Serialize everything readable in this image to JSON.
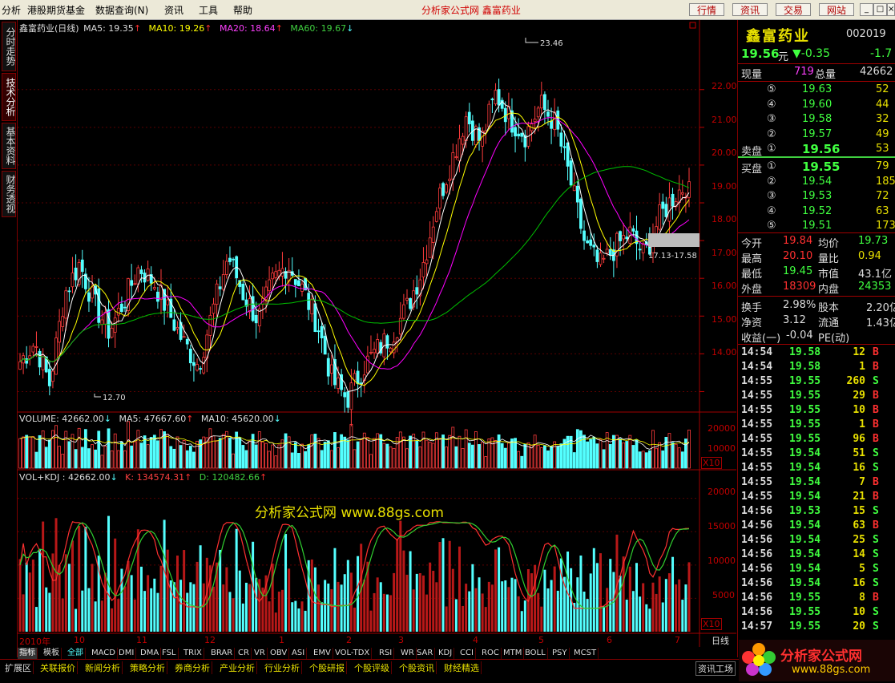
{
  "menu": {
    "items": [
      "分析",
      "港股期货基金",
      "数据查询(N)",
      "资讯",
      "工具",
      "帮助"
    ],
    "center_title": "分析家公式网  鑫富药业",
    "right_buttons": [
      "行情",
      "资讯",
      "交易",
      "网站"
    ],
    "window_buttons": [
      "_",
      "□",
      "×"
    ]
  },
  "left_tabs": [
    "分时走势",
    "技术分析",
    "基本资料",
    "财务透视"
  ],
  "chart": {
    "legend_main": {
      "name": "鑫富药业(日线)",
      "ma5": "MA5: 19.35",
      "ma10": "MA10: 19.26",
      "ma20": "MA20: 18.64",
      "ma60": "MA60: 19.67"
    },
    "legend_volume": {
      "volume": "VOLUME: 42662.00",
      "ma5": "MA5: 47667.60",
      "ma10": "MA10: 45620.00"
    },
    "legend_kdj": {
      "vol": "VOL+KDJ : 42662.00",
      "k": "K: 134574.31",
      "d": "D: 120482.66"
    },
    "price_ticks": [
      "22.00",
      "21.00",
      "20.00",
      "19.00",
      "18.00",
      "17.00",
      "16.00",
      "15.00",
      "14.00"
    ],
    "volume_ticks": [
      "20000",
      "10000"
    ],
    "kdj_ticks": [
      "20000",
      "15000",
      "10000",
      "5000"
    ],
    "scale_label": "X10",
    "annotations": {
      "high": "23.46",
      "low": "12.70",
      "range": "17.13-17.58"
    },
    "watermark": "分析家公式网 www.88gs.com",
    "date_axis": [
      "2010年",
      "10",
      "11",
      "12",
      "1",
      "2",
      "3",
      "4",
      "5",
      "6",
      "7"
    ],
    "period": "日线",
    "colors": {
      "up": "#ff3c3c",
      "down": "#54ffff",
      "ma5": "#ffffff",
      "ma10": "#ffff00",
      "ma20": "#ff00ff",
      "ma60": "#00c000"
    }
  },
  "indicator_tabs": [
    "指标",
    "模板",
    "全部",
    "MACD",
    "DMI",
    "DMA",
    "FSL",
    "TRIX",
    "BRAR",
    "CR",
    "VR",
    "OBV",
    "ASI",
    "EMV",
    "VOL-TDX",
    "RSI",
    "WR",
    "SAR",
    "KDJ",
    "CCI",
    "ROC",
    "MTM",
    "BOLL",
    "PSY",
    "MCST"
  ],
  "quote": {
    "name": "鑫富药业",
    "code": "002019",
    "price": "19.56",
    "unit": "元",
    "change": "▼-0.35",
    "change_pct": "-1.7",
    "current_volume_label": "现量",
    "current_volume": "719",
    "total_volume_label": "总量",
    "total_volume": "42662",
    "sell_label": "卖盘",
    "buy_label": "买盘",
    "sell": [
      {
        "idx": "⑤",
        "price": "19.63",
        "vol": "52"
      },
      {
        "idx": "④",
        "price": "19.60",
        "vol": "44"
      },
      {
        "idx": "③",
        "price": "19.58",
        "vol": "32"
      },
      {
        "idx": "②",
        "price": "19.57",
        "vol": "49"
      },
      {
        "idx": "①",
        "price": "19.56",
        "vol": "53"
      }
    ],
    "buy": [
      {
        "idx": "①",
        "price": "19.55",
        "vol": "79"
      },
      {
        "idx": "②",
        "price": "19.54",
        "vol": "185"
      },
      {
        "idx": "③",
        "price": "19.53",
        "vol": "72"
      },
      {
        "idx": "④",
        "price": "19.52",
        "vol": "63"
      },
      {
        "idx": "⑤",
        "price": "19.51",
        "vol": "173"
      }
    ],
    "stats": [
      {
        "l1": "今开",
        "v1": "19.84",
        "l2": "均价",
        "v2": "19.73"
      },
      {
        "l1": "最高",
        "v1": "20.10",
        "l2": "量比",
        "v2": "0.94"
      },
      {
        "l1": "最低",
        "v1": "19.45",
        "l2": "市值",
        "v2": "43.1亿"
      },
      {
        "l1": "外盘",
        "v1": "18309",
        "l2": "内盘",
        "v2": "24353"
      }
    ],
    "fundamentals": [
      {
        "l1": "换手",
        "v1": "2.98%",
        "l2": "股本",
        "v2": "2.20亿"
      },
      {
        "l1": "净资",
        "v1": "3.12",
        "l2": "流通",
        "v2": "1.43亿"
      },
      {
        "l1": "收益(一)",
        "v1": "-0.04",
        "l2": "PE(动)",
        "v2": ""
      }
    ],
    "ticks": [
      {
        "time": "14:54",
        "price": "19.58",
        "vol": "12",
        "side": "B"
      },
      {
        "time": "14:54",
        "price": "19.58",
        "vol": "1",
        "side": "B"
      },
      {
        "time": "14:55",
        "price": "19.55",
        "vol": "260",
        "side": "S"
      },
      {
        "time": "14:55",
        "price": "19.55",
        "vol": "29",
        "side": "B"
      },
      {
        "time": "14:55",
        "price": "19.55",
        "vol": "10",
        "side": "B"
      },
      {
        "time": "14:55",
        "price": "19.55",
        "vol": "1",
        "side": "B"
      },
      {
        "time": "14:55",
        "price": "19.55",
        "vol": "96",
        "side": "B"
      },
      {
        "time": "14:55",
        "price": "19.54",
        "vol": "51",
        "side": "S"
      },
      {
        "time": "14:55",
        "price": "19.54",
        "vol": "16",
        "side": "S"
      },
      {
        "time": "14:55",
        "price": "19.54",
        "vol": "7",
        "side": "B"
      },
      {
        "time": "14:55",
        "price": "19.54",
        "vol": "21",
        "side": "B"
      },
      {
        "time": "14:56",
        "price": "19.53",
        "vol": "15",
        "side": "S"
      },
      {
        "time": "14:56",
        "price": "19.54",
        "vol": "63",
        "side": "B"
      },
      {
        "time": "14:56",
        "price": "19.54",
        "vol": "25",
        "side": "S"
      },
      {
        "time": "14:56",
        "price": "19.54",
        "vol": "14",
        "side": "S"
      },
      {
        "time": "14:56",
        "price": "19.54",
        "vol": "5",
        "side": "S"
      },
      {
        "time": "14:56",
        "price": "19.54",
        "vol": "16",
        "side": "S"
      },
      {
        "time": "14:56",
        "price": "19.55",
        "vol": "8",
        "side": "B"
      },
      {
        "time": "14:56",
        "price": "19.55",
        "vol": "10",
        "side": "S"
      },
      {
        "time": "14:57",
        "price": "19.55",
        "vol": "20",
        "side": "S"
      }
    ]
  },
  "statusbar": {
    "items": [
      "扩展区",
      "关联报价",
      "新闻分析",
      "策略分析",
      "券商分析",
      "产业分析",
      "行业分析",
      "个股研报",
      "个股评级",
      "个股资讯",
      "财经精选"
    ],
    "right_label": "资讯工场",
    "logo_text": "分析家公式网",
    "logo_url": "www.88gs.com"
  },
  "chart_data": {
    "type": "candlestick",
    "symbol": "鑫富药业",
    "period": "日线",
    "title": "鑫富药业(日线)",
    "y_range": [
      13.5,
      23.8
    ],
    "y_ticks": [
      14,
      15,
      16,
      17,
      18,
      19,
      20,
      21,
      22
    ],
    "x_months": [
      "2010年",
      "10",
      "11",
      "12",
      "1",
      "2",
      "3",
      "4",
      "5",
      "6",
      "7"
    ],
    "high_marker": 23.46,
    "low_marker": 12.7,
    "last_close": 19.56,
    "moving_averages": {
      "MA5": 19.35,
      "MA10": 19.26,
      "MA20": 18.64,
      "MA60": 19.67
    },
    "close_keypoints": [
      14.8,
      15.3,
      14.2,
      16.6,
      17.4,
      16.3,
      15.6,
      16.4,
      17.3,
      16.9,
      16.1,
      15.3,
      14.7,
      16.2,
      17.6,
      16.6,
      15.9,
      16.9,
      17.4,
      16.7,
      15.8,
      14.3,
      13.8,
      14.6,
      15.1,
      15.5,
      16.2,
      17.2,
      18.9,
      20.1,
      21.3,
      20.6,
      21.9,
      21.2,
      20.8,
      21.6,
      21.1,
      19.6,
      17.9,
      17.3,
      17.8,
      18.2,
      17.6,
      18.6,
      19.2,
      19.56
    ],
    "volume": {
      "last": 42662,
      "MA5": 47667.6,
      "MA10": 45620,
      "y_ticks": [
        10000,
        20000
      ],
      "unit": "X10"
    },
    "kdj": {
      "vol": 42662,
      "K": 134574.31,
      "D": 120482.66,
      "y_ticks": [
        5000,
        10000,
        15000,
        20000
      ],
      "unit": "X10"
    }
  }
}
